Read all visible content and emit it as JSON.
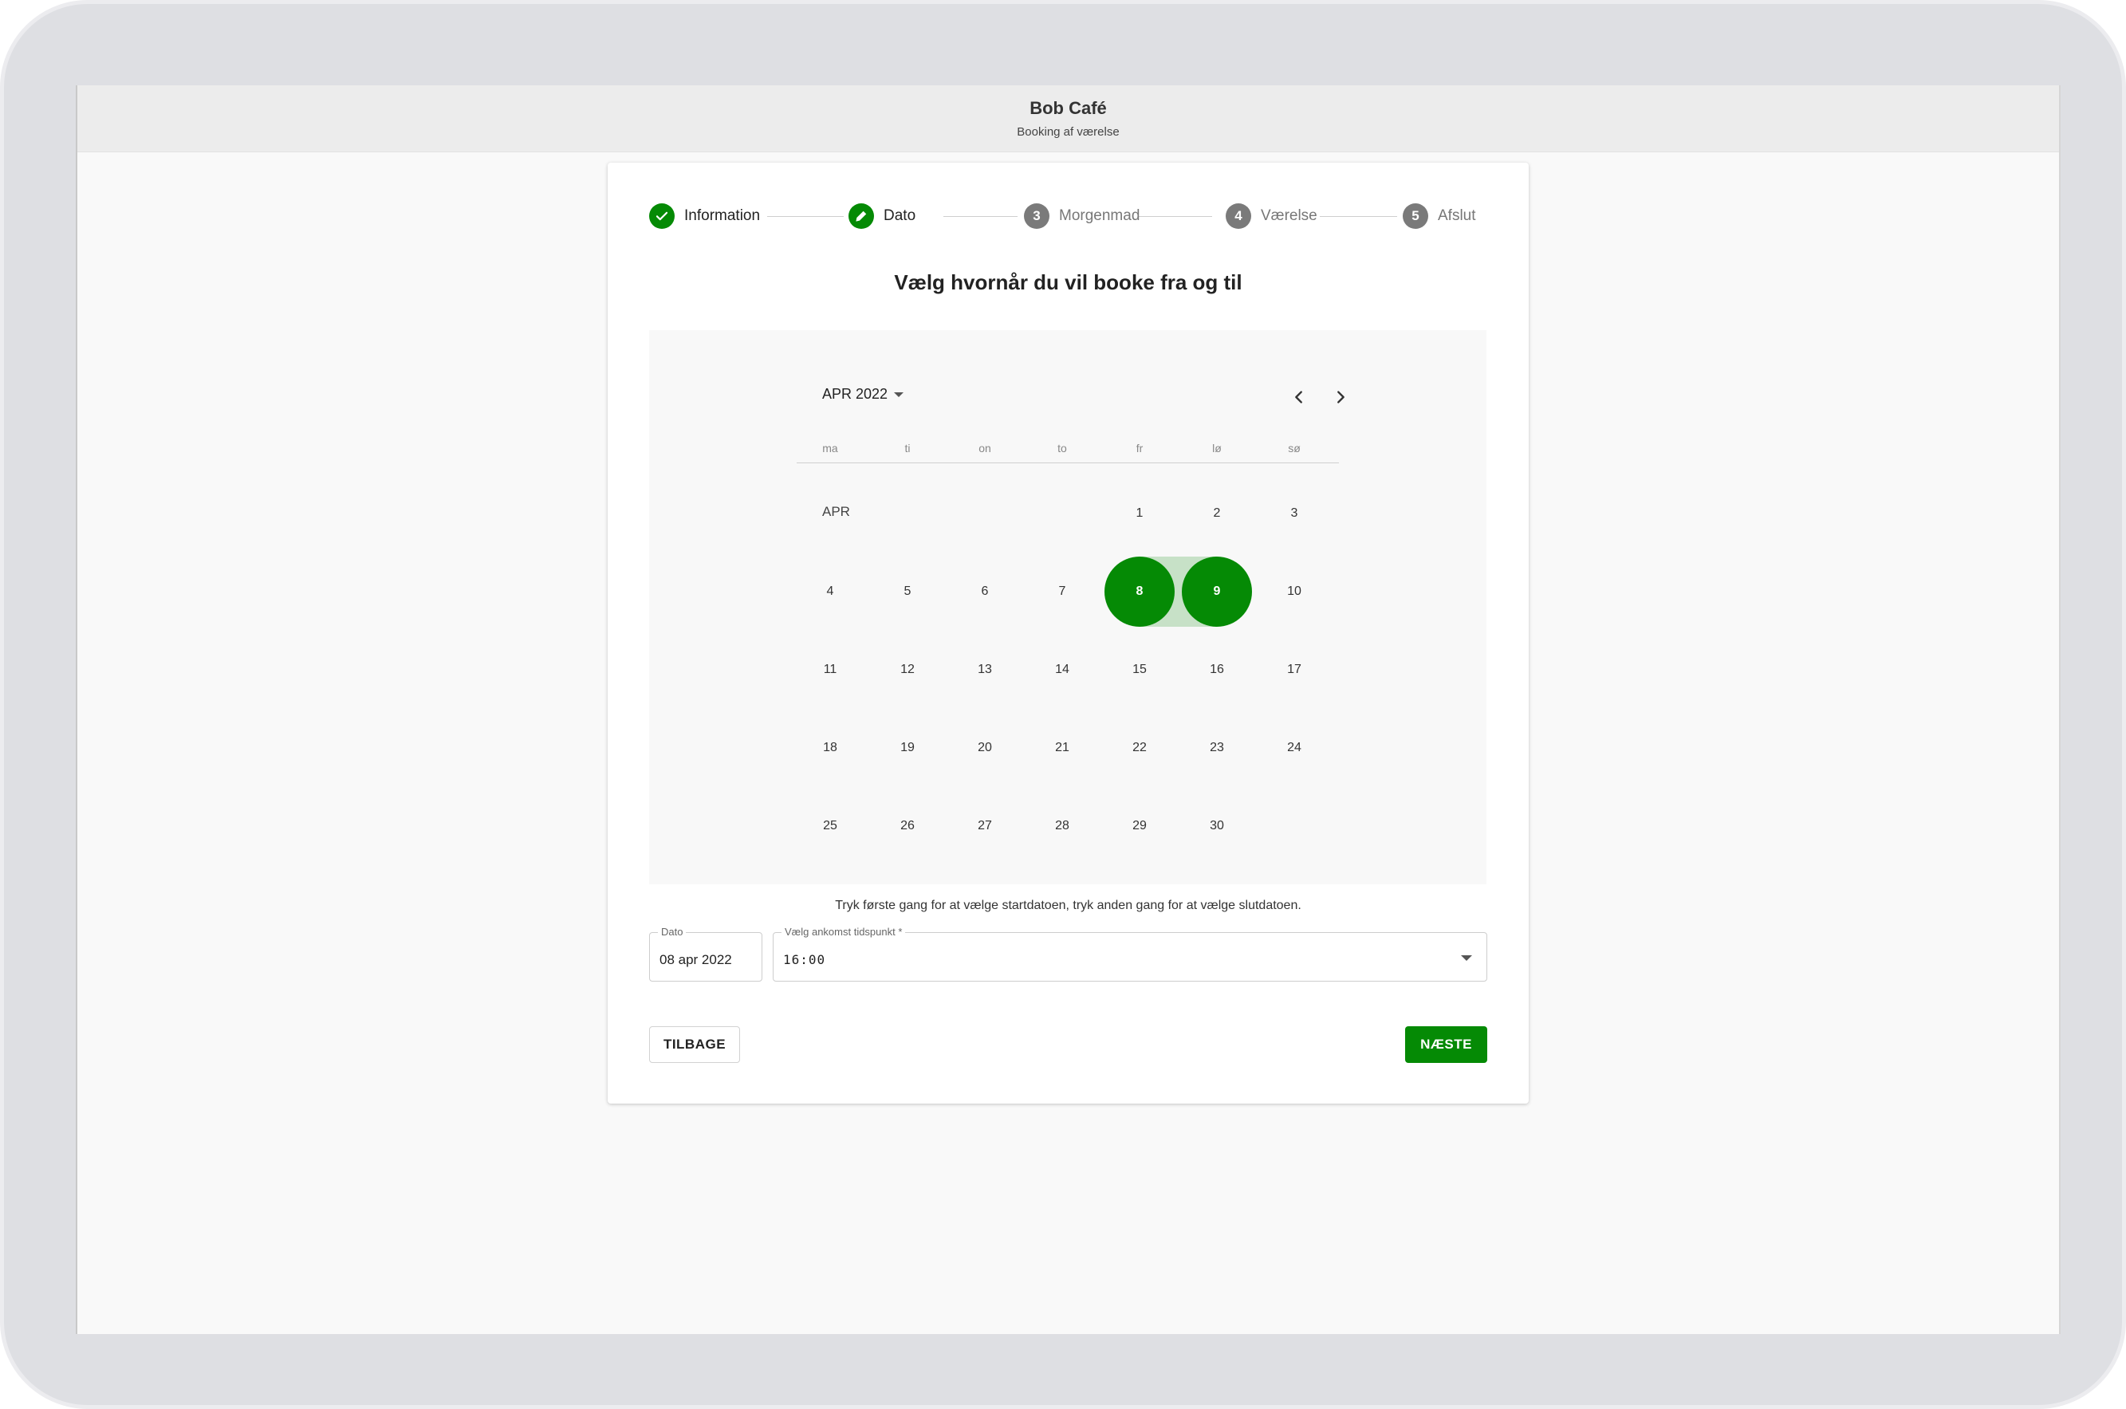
{
  "app": {
    "title": "Bob Café",
    "subtitle": "Booking af værelse"
  },
  "stepper": {
    "steps": [
      {
        "label": "Information",
        "state": "completed",
        "icon": "check-icon"
      },
      {
        "label": "Dato",
        "state": "active",
        "icon": "pencil-icon"
      },
      {
        "label": "Morgenmad",
        "state": "pending",
        "number": "3"
      },
      {
        "label": "Værelse",
        "state": "pending",
        "number": "4"
      },
      {
        "label": "Afslut",
        "state": "pending",
        "number": "5"
      }
    ]
  },
  "heading": "Vælg hvornår du vil booke fra og til",
  "calendar": {
    "month_year": "APR 2022",
    "month_label": "APR",
    "weekdays": [
      "ma",
      "ti",
      "on",
      "to",
      "fr",
      "lø",
      "sø"
    ],
    "first_weekday_index": 4,
    "days_in_month": 30,
    "selected_start": 8,
    "selected_end": 9,
    "accent_color": "#058a05",
    "range_color": "#c7e1c7"
  },
  "hint": "Tryk første gang for at vælge startdatoen, tryk anden gang for at vælge slutdatoen.",
  "date_field": {
    "label": "Dato",
    "value": "08 apr 2022"
  },
  "arrival_field": {
    "label": "Vælg ankomst tidspunkt *",
    "value": "16:00"
  },
  "buttons": {
    "back": "TILBAGE",
    "next": "NÆSTE"
  }
}
